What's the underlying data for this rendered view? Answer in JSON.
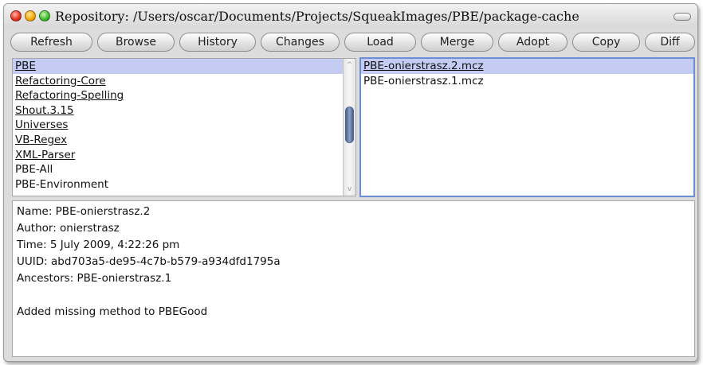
{
  "window": {
    "title": "Repository: /Users/oscar/Documents/Projects/SqueakImages/PBE/package-cache"
  },
  "toolbar": {
    "buttons": [
      "Refresh",
      "Browse",
      "History",
      "Changes",
      "Load",
      "Merge",
      "Adopt",
      "Copy",
      "Diff"
    ]
  },
  "packages": {
    "items": [
      "PBE",
      "Refactoring-Core",
      "Refactoring-Spelling",
      "Shout.3.15",
      "Universes",
      "VB-Regex",
      "XML-Parser",
      "PBE-All",
      "PBE-Environment"
    ],
    "selected": "PBE",
    "scroll_up_glyph": "^",
    "scroll_down_glyph": "v"
  },
  "versions": {
    "items": [
      "PBE-onierstrasz.2.mcz",
      "PBE-onierstrasz.1.mcz"
    ],
    "selected": "PBE-onierstrasz.2.mcz"
  },
  "info": {
    "name": "Name: PBE-onierstrasz.2",
    "author": "Author: onierstrasz",
    "time": "Time: 5 July 2009, 4:22:26 pm",
    "uuid": "UUID: abd703a5-de95-4c7b-b579-a934dfd1795a",
    "ancestors": "Ancestors: PBE-onierstrasz.1",
    "message": "Added missing method to PBEGood"
  },
  "colors": {
    "selection": "#c5ccf3",
    "focus_border": "#6b8ed8",
    "scroll_thumb": "#5a6f98"
  }
}
